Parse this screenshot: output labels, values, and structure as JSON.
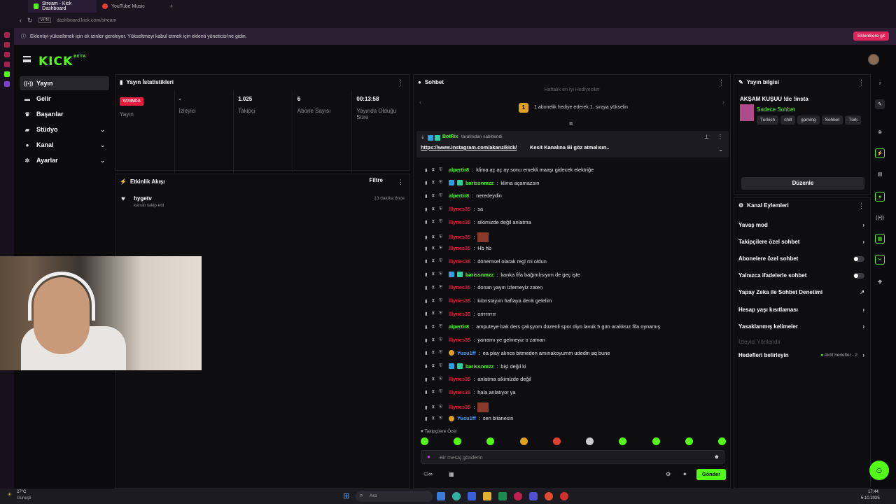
{
  "browser": {
    "tabs": [
      {
        "label": "Stream - Kick Dashboard",
        "active": true,
        "color": "#53fc18"
      },
      {
        "label": "YouTube Music",
        "active": false,
        "color": "#e53935"
      }
    ],
    "url": "dashboard.kick.com/stream",
    "vpn_label": "VPN"
  },
  "notice": {
    "text": "Eklentiyi yükseltmek için ek izinler gerekiyor. Yükseltmeyi kabul etmek için eklenti yöneticisi'ne gidin.",
    "button": "Eklentilere git"
  },
  "logo": {
    "text": "KICK",
    "sup": "BETA"
  },
  "nav": [
    {
      "label": "Yayın",
      "icon": "broadcast-icon",
      "glyph": "((•))",
      "active": true
    },
    {
      "label": "Gelir",
      "icon": "money-icon",
      "glyph": "▬"
    },
    {
      "label": "Başarılar",
      "icon": "trophy-icon",
      "glyph": "♛"
    },
    {
      "label": "Stüdyo",
      "icon": "studio-icon",
      "glyph": "▰",
      "chev": "⌄"
    },
    {
      "label": "Kanal",
      "icon": "user-icon",
      "glyph": "●",
      "chev": "⌄"
    },
    {
      "label": "Ayarlar",
      "icon": "gear-icon",
      "glyph": "✲",
      "chev": "⌄"
    }
  ],
  "stats": {
    "title": "Yayın İstatistikleri",
    "cells": [
      {
        "value": "YAYINDA",
        "label": "Yayın",
        "live": true
      },
      {
        "value": "-",
        "label": "İzleyici"
      },
      {
        "value": "1.025",
        "label": "Takipçi"
      },
      {
        "value": "6",
        "label": "Abone Sayısı"
      },
      {
        "value": "00:13:58",
        "label": "Yayında Olduğu Süre"
      }
    ]
  },
  "activity": {
    "title": "Etkinlik Akışı",
    "filter": "Filtre",
    "items": [
      {
        "user": "hygetv",
        "action": "kanalı takip etti",
        "time": "13 dakika önce"
      }
    ]
  },
  "chat": {
    "title": "Sohbet",
    "top_gifters": "Haftalık en İyi Hediyeciler",
    "gift_prompt": "1 abonelik hediye ederek 1. sıraya yükselin",
    "gift_rank": "1",
    "pinned": {
      "by": "BotRix",
      "by_suffix": "tarafından sabitlendi",
      "link": "https://www.instagram.com/akanzikick/",
      "text": "Kesit Kanalına Bi göz atmalısın.."
    },
    "messages": [
      {
        "user": "alpertir8",
        "color": "green",
        "text": "klima aç aç ay sonu emekli maaşı gidecek elektriğe"
      },
      {
        "user": "barissnmzz",
        "color": "green",
        "badges": true,
        "text": "klima açamazsın"
      },
      {
        "user": "alpertir8",
        "color": "green",
        "text": "neredeydin"
      },
      {
        "user": "lllynes35",
        "color": "red",
        "text": "sa"
      },
      {
        "user": "lllynes35",
        "color": "red",
        "text": "sikimizde değil anlatma"
      },
      {
        "user": "lllynes35",
        "color": "red",
        "text": "",
        "emote": true
      },
      {
        "user": "lllynes35",
        "color": "red",
        "text": "Hb hb"
      },
      {
        "user": "lllynes35",
        "color": "red",
        "text": "dönemsel olarak regl mi oldun"
      },
      {
        "user": "barissnmzz",
        "color": "green",
        "badges": true,
        "text": "kanka fifa bağımlısıyım de geç işte"
      },
      {
        "user": "lllynes35",
        "color": "red",
        "text": "donan yayın izlemeyiz zaten"
      },
      {
        "user": "lllynes35",
        "color": "red",
        "text": "kıbrıstayım haftaya denk gelelim"
      },
      {
        "user": "lllynes35",
        "color": "red",
        "text": "orrrrrrrrr"
      },
      {
        "user": "alpertir8",
        "color": "green",
        "text": "amputeye bak ders çalışyom düzenli spor diyo lavuk 5 gün aralıksız fifa oynamış"
      },
      {
        "user": "lllynes35",
        "color": "red",
        "text": "yarramı ye gelmeyiz o zaman"
      },
      {
        "user": "Yusu1ff",
        "color": "blue",
        "coin": true,
        "text": "ea play alınca bitmeden amınakoyumm udedin aq bune"
      },
      {
        "user": "barissnmzz",
        "color": "green",
        "badges": true,
        "text": "bişi değil ki"
      },
      {
        "user": "lllynes35",
        "color": "red",
        "text": "anlatma sikimizde değil"
      },
      {
        "user": "lllynes35",
        "color": "red",
        "text": "hala anlatıyor ya"
      },
      {
        "user": "lllynes35",
        "color": "red",
        "text": "",
        "emote": true
      },
      {
        "user": "Yusu1ff",
        "color": "blue",
        "coin": true,
        "text": "sen bitanesin"
      }
    ],
    "followers_only_label": "Takipçilere Özel",
    "input_placeholder": "Bir mesaj gönderin",
    "send": "Gönder"
  },
  "stream_info": {
    "title_panel": "Yayın bilgisi",
    "stream_title": "AKŞAM KUŞUU !dc !insta",
    "category": "Sadece Sohbet",
    "tags": [
      "Turkish",
      "chill",
      "gaming",
      "Sohbet",
      "Türk"
    ],
    "edit": "Düzenle"
  },
  "channel_actions": {
    "title": "Kanal Eylemleri",
    "items": [
      {
        "label": "Yavaş mod",
        "type": "chev"
      },
      {
        "label": "Takipçilere özel sohbet",
        "type": "chev"
      },
      {
        "label": "Abonelere özel sohbet",
        "type": "toggle"
      },
      {
        "label": "Yalnızca ifadelerle sohbet",
        "type": "toggle"
      },
      {
        "label": "Yapay Zeka ile Sohbet Denetimi",
        "type": "ext"
      },
      {
        "label": "Hesap yaşı kısıtlaması",
        "type": "chev"
      },
      {
        "label": "Yasaklanmış kelimeler",
        "type": "chev"
      },
      {
        "label": "İzleyici Yönlendir",
        "type": "disabled"
      },
      {
        "label": "Hedefleri belirleyin",
        "type": "goal",
        "extra": "Aktif hedefler - 2"
      }
    ]
  },
  "taskbar": {
    "weather": "27°C",
    "weather_sub": "Güneşli",
    "search": "Ara",
    "time": "17:44",
    "date": "5.10.2025"
  },
  "colors": {
    "accent": "#53fc18",
    "live": "#e91e3f",
    "brand_browser": "#a3214a"
  }
}
